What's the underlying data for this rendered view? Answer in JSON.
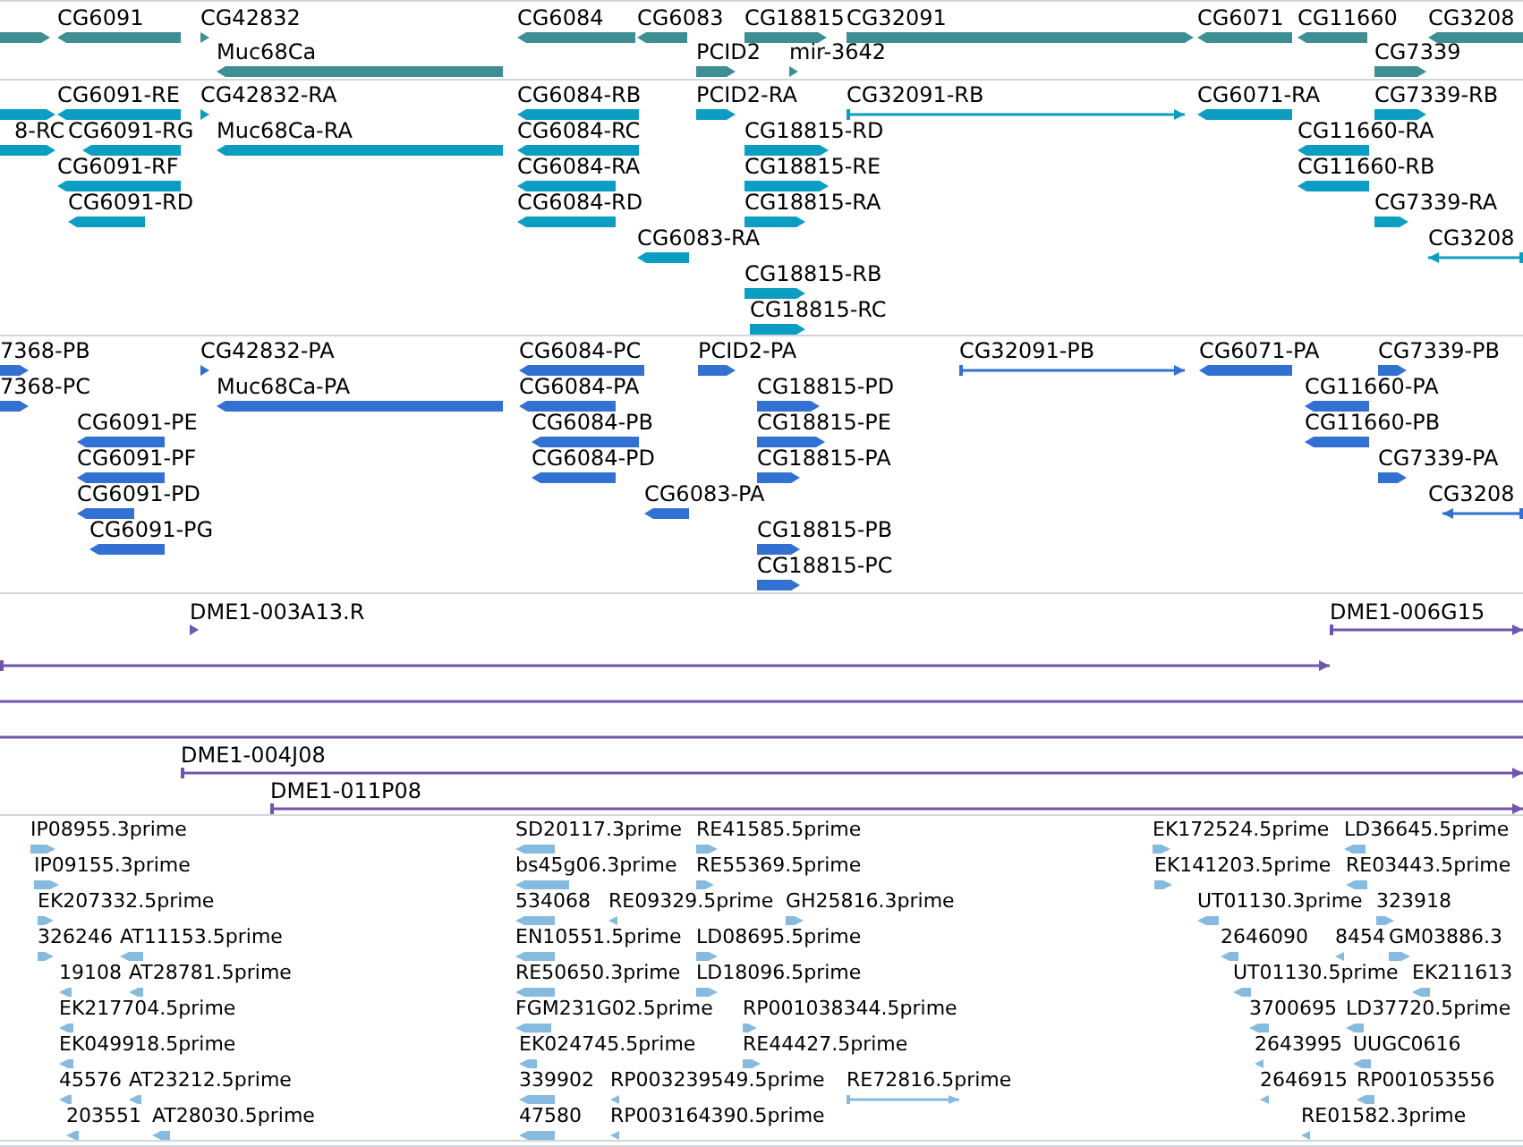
{
  "tracks": [
    {
      "color": "#3e8e94",
      "features": [
        {
          "kind": "forward"
        },
        {
          "label": "CG6091",
          "kind": "reverse"
        },
        {
          "label": "CG42832",
          "kind": "forward"
        },
        {
          "label": "Muc68Ca",
          "kind": "reverse"
        },
        {
          "label": "CG6084",
          "kind": "reverse"
        },
        {
          "label": "CG6083",
          "kind": "reverse"
        },
        {
          "label": "PCID2",
          "kind": "forward"
        },
        {
          "label": "CG18815",
          "kind": "forward"
        },
        {
          "label": "mir-3642",
          "kind": "forward"
        },
        {
          "label": "CG32091",
          "kind": "forward"
        },
        {
          "label": "CG6071",
          "kind": "reverse"
        },
        {
          "label": "CG11660",
          "kind": "reverse"
        },
        {
          "label": "CG3208",
          "kind": "reverse"
        },
        {
          "label": "CG7339",
          "kind": "forward"
        }
      ]
    },
    {
      "color": "#0b9ec2",
      "features": [
        {
          "kind": "forward"
        },
        {
          "label": "8-RC",
          "kind": "forward"
        },
        {
          "label": "CG6091-RE",
          "kind": "reverse"
        },
        {
          "label": "CG6091-RG",
          "kind": "reverse"
        },
        {
          "label": "CG6091-RF",
          "kind": "reverse"
        },
        {
          "label": "CG6091-RD",
          "kind": "reverse"
        },
        {
          "label": "CG42832-RA",
          "kind": "forward"
        },
        {
          "label": "Muc68Ca-RA",
          "kind": "reverse"
        },
        {
          "label": "CG6084-RB",
          "kind": "reverse"
        },
        {
          "label": "CG6084-RC",
          "kind": "reverse"
        },
        {
          "label": "CG6084-RA",
          "kind": "reverse"
        },
        {
          "label": "CG6084-RD",
          "kind": "reverse"
        },
        {
          "label": "CG6083-RA",
          "kind": "reverse"
        },
        {
          "label": "PCID2-RA",
          "kind": "forward"
        },
        {
          "label": "CG18815-RD",
          "kind": "forward"
        },
        {
          "label": "CG18815-RE",
          "kind": "forward"
        },
        {
          "label": "CG18815-RA",
          "kind": "forward"
        },
        {
          "label": "CG18815-RB",
          "kind": "forward"
        },
        {
          "label": "CG18815-RC",
          "kind": "forward"
        },
        {
          "label": "CG32091-RB",
          "kind": "forward-line"
        },
        {
          "label": "CG6071-RA",
          "kind": "reverse"
        },
        {
          "label": "CG11660-RA",
          "kind": "reverse"
        },
        {
          "label": "CG11660-RB",
          "kind": "reverse"
        },
        {
          "label": "CG7339-RB",
          "kind": "forward"
        },
        {
          "label": "CG7339-RA",
          "kind": "forward"
        },
        {
          "label": "CG3208",
          "kind": "reverse-line"
        }
      ]
    },
    {
      "color": "#3270d2",
      "features": [
        {
          "label": "7368-PB",
          "kind": "forward"
        },
        {
          "label": "7368-PC",
          "kind": "forward"
        },
        {
          "label": "CG42832-PA",
          "kind": "forward"
        },
        {
          "label": "Muc68Ca-PA",
          "kind": "reverse"
        },
        {
          "label": "CG6091-PE",
          "kind": "reverse"
        },
        {
          "label": "CG6091-PF",
          "kind": "reverse"
        },
        {
          "label": "CG6091-PD",
          "kind": "reverse"
        },
        {
          "label": "CG6091-PG",
          "kind": "reverse"
        },
        {
          "label": "CG6084-PC",
          "kind": "reverse"
        },
        {
          "label": "CG6084-PA",
          "kind": "reverse"
        },
        {
          "label": "CG6084-PB",
          "kind": "reverse"
        },
        {
          "label": "CG6084-PD",
          "kind": "reverse"
        },
        {
          "label": "CG6083-PA",
          "kind": "reverse"
        },
        {
          "label": "PCID2-PA",
          "kind": "forward"
        },
        {
          "label": "CG18815-PD",
          "kind": "forward"
        },
        {
          "label": "CG18815-PE",
          "kind": "forward"
        },
        {
          "label": "CG18815-PA",
          "kind": "forward"
        },
        {
          "label": "CG18815-PB",
          "kind": "forward"
        },
        {
          "label": "CG18815-PC",
          "kind": "forward"
        },
        {
          "label": "CG32091-PB",
          "kind": "forward-line"
        },
        {
          "label": "CG6071-PA",
          "kind": "reverse"
        },
        {
          "label": "CG11660-PA",
          "kind": "reverse"
        },
        {
          "label": "CG11660-PB",
          "kind": "reverse"
        },
        {
          "label": "CG7339-PB",
          "kind": "forward"
        },
        {
          "label": "CG7339-PA",
          "kind": "forward"
        },
        {
          "label": "CG3208",
          "kind": "reverse-line"
        }
      ]
    },
    {
      "color": "#7054b0",
      "features": [
        {
          "label": "DME1-003A13.R",
          "kind": "forward"
        },
        {
          "label": "DME1-006G15",
          "kind": "forward-line"
        },
        {
          "kind": "forward-line"
        },
        {
          "kind": "line"
        },
        {
          "kind": "line"
        },
        {
          "label": "DME1-004J08",
          "kind": "forward-line"
        },
        {
          "label": "DME1-011P08",
          "kind": "forward-line"
        }
      ]
    },
    {
      "color": "#86bade",
      "features": [
        {
          "label": "IP08955.3prime",
          "kind": "forward"
        },
        {
          "label": "IP09155.3prime",
          "kind": "forward"
        },
        {
          "label": "EK207332.5prime",
          "kind": "forward"
        },
        {
          "label": "326246",
          "kind": "forward"
        },
        {
          "label": "AT11153.5prime",
          "kind": "reverse"
        },
        {
          "label": "19108",
          "kind": "reverse"
        },
        {
          "label": "AT28781.5prime",
          "kind": "reverse"
        },
        {
          "label": "EK217704.5prime",
          "kind": "reverse"
        },
        {
          "label": "EK049918.5prime",
          "kind": "reverse"
        },
        {
          "label": "45576",
          "kind": "reverse"
        },
        {
          "label": "AT23212.5prime",
          "kind": "reverse"
        },
        {
          "label": "203551",
          "kind": "reverse"
        },
        {
          "label": "AT28030.5prime",
          "kind": "reverse"
        },
        {
          "label": "SD20117.3prime",
          "kind": "reverse"
        },
        {
          "label": "RE41585.5prime",
          "kind": "forward"
        },
        {
          "label": "bs45g06.3prime",
          "kind": "reverse"
        },
        {
          "label": "RE55369.5prime",
          "kind": "forward"
        },
        {
          "label": "534068",
          "kind": "reverse"
        },
        {
          "label": "RE09329.5prime",
          "kind": "reverse"
        },
        {
          "label": "GH25816.3prime",
          "kind": "forward"
        },
        {
          "label": "EN10551.5prime",
          "kind": "reverse"
        },
        {
          "label": "LD08695.5prime",
          "kind": "forward"
        },
        {
          "label": "RE50650.3prime",
          "kind": "reverse"
        },
        {
          "label": "LD18096.5prime",
          "kind": "forward"
        },
        {
          "label": "FGM231G02.5prime",
          "kind": "reverse"
        },
        {
          "label": "RP001038344.5prime",
          "kind": "forward"
        },
        {
          "label": "EK024745.5prime",
          "kind": "reverse"
        },
        {
          "label": "RE44427.5prime",
          "kind": "forward"
        },
        {
          "label": "339902",
          "kind": "reverse"
        },
        {
          "label": "RP003239549.5prime",
          "kind": "reverse"
        },
        {
          "label": "RE72816.5prime",
          "kind": "forward-line"
        },
        {
          "label": "47580",
          "kind": "reverse"
        },
        {
          "label": "RP003164390.5prime",
          "kind": "reverse"
        },
        {
          "label": "EK172524.5prime",
          "kind": "forward"
        },
        {
          "label": "LD36645.5prime",
          "kind": "reverse"
        },
        {
          "label": "EK141203.5prime",
          "kind": "forward"
        },
        {
          "label": "RE03443.5prime",
          "kind": "reverse"
        },
        {
          "label": "UT01130.3prime",
          "kind": "reverse"
        },
        {
          "label": "323918",
          "kind": "forward"
        },
        {
          "label": "2646090",
          "kind": "reverse"
        },
        {
          "label": "8454",
          "kind": "reverse"
        },
        {
          "label": "GM03886.3",
          "kind": "forward"
        },
        {
          "label": "UT01130.5prime",
          "kind": "reverse"
        },
        {
          "label": "EK211613",
          "kind": "reverse"
        },
        {
          "label": "3700695",
          "kind": "reverse"
        },
        {
          "label": "LD37720.5prime",
          "kind": "reverse"
        },
        {
          "label": "2643995",
          "kind": "reverse"
        },
        {
          "label": "UUGC0616",
          "kind": "reverse"
        },
        {
          "label": "2646915",
          "kind": "reverse"
        },
        {
          "label": "RP001053556",
          "kind": "reverse"
        },
        {
          "label": "RE01582.3prime",
          "kind": "reverse"
        }
      ]
    }
  ]
}
